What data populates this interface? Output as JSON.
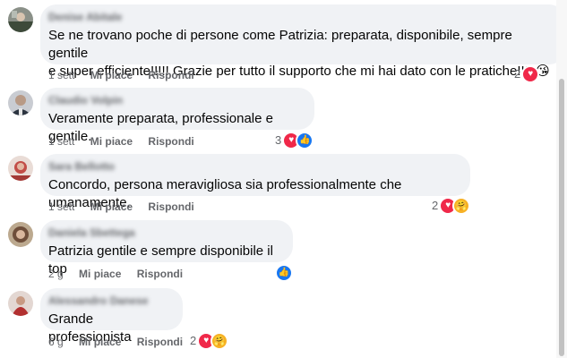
{
  "colors": {
    "bubble_bg": "#f0f2f5",
    "meta_text": "#65676b",
    "heart": "#f02849",
    "like": "#1877f2",
    "care": "#f7b125"
  },
  "action_labels": {
    "like": "Mi piace",
    "reply": "Rispondi"
  },
  "comments": [
    {
      "author": "Denise Abitale",
      "text_line1": "Se ne trovano poche di persone come Patrizia: preparata, disponibile, sempre gentile",
      "text_line2": "e super efficiente!!!!! Grazie per tutto il supporto che mi hai dato con le pratiche!!!! 😘",
      "time": "1 sett",
      "reaction_count": "2",
      "reactions": [
        "heart-icon"
      ]
    },
    {
      "author": "Claudio Volpin",
      "text_line1": "Veramente preparata, professionale e gentile.",
      "time": "1 sett",
      "reaction_count": "3",
      "reactions": [
        "heart-icon",
        "like-icon"
      ]
    },
    {
      "author": "Sara Bellotto",
      "text_line1": "Concordo, persona meravigliosa sia professionalmente che umanamente.",
      "time": "1 sett",
      "reaction_count": "2",
      "reactions": [
        "heart-icon",
        "care-icon"
      ]
    },
    {
      "author": "Daniela Sbettega",
      "text_line1": "Patrizia gentile e sempre disponibile il top",
      "time": "2 g",
      "reaction_count": "",
      "reactions": [
        "like-icon"
      ]
    },
    {
      "author": "Alessandro Danese",
      "text_line1": "Grande professionista",
      "time": "6 g",
      "reaction_count": "2",
      "reactions": [
        "heart-icon",
        "care-icon"
      ]
    }
  ]
}
